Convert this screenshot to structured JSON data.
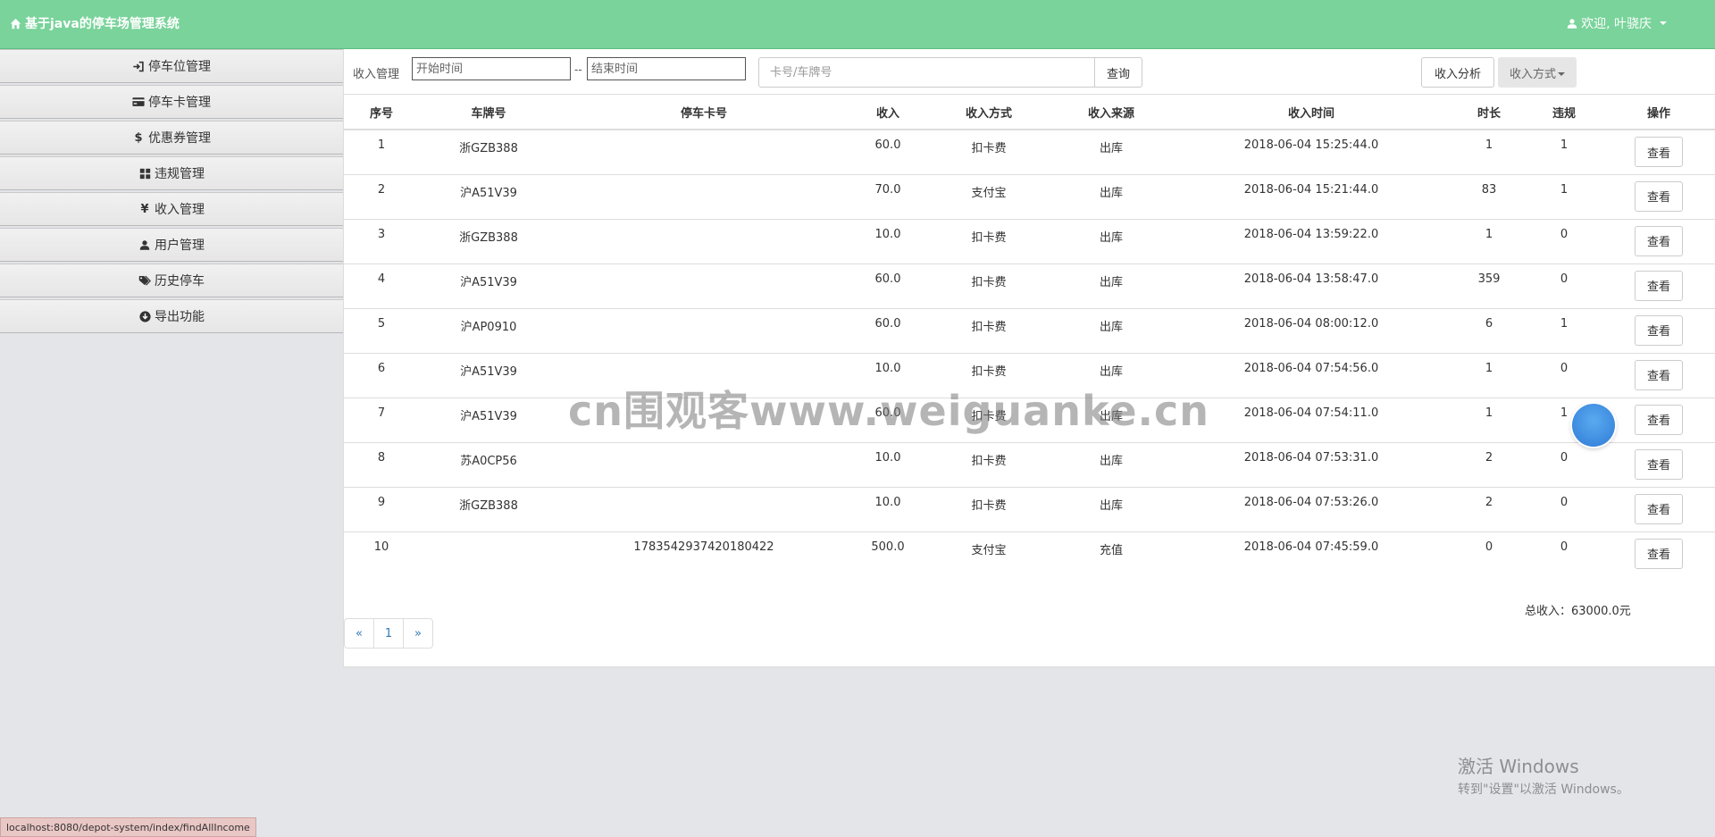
{
  "app": {
    "title": "基于java的停车场管理系统",
    "user_greeting": "欢迎, 叶骁庆"
  },
  "sidebar": {
    "items": [
      {
        "label": "停车位管理",
        "icon": "sign-in-icon"
      },
      {
        "label": "停车卡管理",
        "icon": "credit-card-icon"
      },
      {
        "label": "优惠券管理",
        "icon": "dollar-icon"
      },
      {
        "label": "违规管理",
        "icon": "th-large-icon"
      },
      {
        "label": "收入管理",
        "icon": "yen-icon"
      },
      {
        "label": "用户管理",
        "icon": "user-icon"
      },
      {
        "label": "历史停车",
        "icon": "tags-icon"
      },
      {
        "label": "导出功能",
        "icon": "download-icon"
      }
    ]
  },
  "toolbar": {
    "label": "收入管理",
    "start_placeholder": "开始时间",
    "separator": "--",
    "end_placeholder": "结束时间",
    "search_placeholder": "卡号/车牌号",
    "search_button": "查询",
    "analysis_button": "收入分析",
    "method_button": "收入方式"
  },
  "table": {
    "headers": [
      "序号",
      "车牌号",
      "停车卡号",
      "收入",
      "收入方式",
      "收入来源",
      "收入时间",
      "时长",
      "违规",
      "操作"
    ],
    "view_label": "查看",
    "rows": [
      {
        "no": "1",
        "plate": "浙GZB388",
        "card": "",
        "income": "60.0",
        "method": "扣卡费",
        "source": "出库",
        "time": "2018-06-04 15:25:44.0",
        "duration": "1",
        "violation": "1"
      },
      {
        "no": "2",
        "plate": "沪A51V39",
        "card": "",
        "income": "70.0",
        "method": "支付宝",
        "source": "出库",
        "time": "2018-06-04 15:21:44.0",
        "duration": "83",
        "violation": "1"
      },
      {
        "no": "3",
        "plate": "浙GZB388",
        "card": "",
        "income": "10.0",
        "method": "扣卡费",
        "source": "出库",
        "time": "2018-06-04 13:59:22.0",
        "duration": "1",
        "violation": "0"
      },
      {
        "no": "4",
        "plate": "沪A51V39",
        "card": "",
        "income": "60.0",
        "method": "扣卡费",
        "source": "出库",
        "time": "2018-06-04 13:58:47.0",
        "duration": "359",
        "violation": "0"
      },
      {
        "no": "5",
        "plate": "沪AP0910",
        "card": "",
        "income": "60.0",
        "method": "扣卡费",
        "source": "出库",
        "time": "2018-06-04 08:00:12.0",
        "duration": "6",
        "violation": "1"
      },
      {
        "no": "6",
        "plate": "沪A51V39",
        "card": "",
        "income": "10.0",
        "method": "扣卡费",
        "source": "出库",
        "time": "2018-06-04 07:54:56.0",
        "duration": "1",
        "violation": "0"
      },
      {
        "no": "7",
        "plate": "沪A51V39",
        "card": "",
        "income": "60.0",
        "method": "扣卡费",
        "source": "出库",
        "time": "2018-06-04 07:54:11.0",
        "duration": "1",
        "violation": "1"
      },
      {
        "no": "8",
        "plate": "苏A0CP56",
        "card": "",
        "income": "10.0",
        "method": "扣卡费",
        "source": "出库",
        "time": "2018-06-04 07:53:31.0",
        "duration": "2",
        "violation": "0"
      },
      {
        "no": "9",
        "plate": "浙GZB388",
        "card": "",
        "income": "10.0",
        "method": "扣卡费",
        "source": "出库",
        "time": "2018-06-04 07:53:26.0",
        "duration": "2",
        "violation": "0"
      },
      {
        "no": "10",
        "plate": "",
        "card": "1783542937420180422",
        "income": "500.0",
        "method": "支付宝",
        "source": "充值",
        "time": "2018-06-04 07:45:59.0",
        "duration": "0",
        "violation": "0"
      }
    ]
  },
  "summary": {
    "total": "总收入：63000.0元"
  },
  "pagination": {
    "prev": "«",
    "current": "1",
    "next": "»"
  },
  "overlay": {
    "watermark": "cn围观客www.weiguanke.cn",
    "activation_title": "激活 Windows",
    "activation_sub": "转到\"设置\"以激活 Windows。",
    "status_url": "localhost:8080/depot-system/index/findAllIncome"
  },
  "colors": {
    "header_bg": "#79d39a",
    "link": "#337ab7"
  }
}
